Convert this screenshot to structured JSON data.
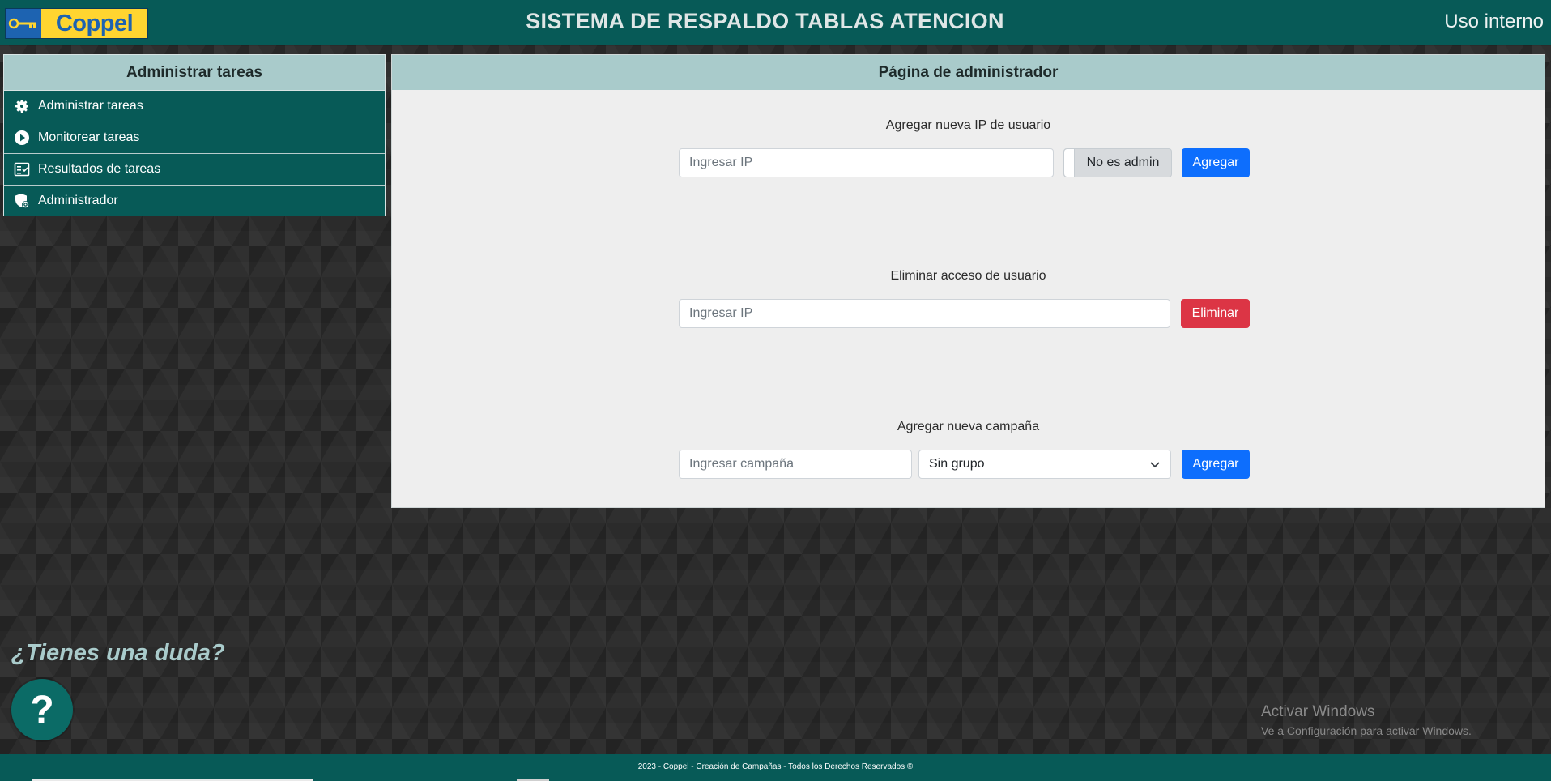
{
  "header": {
    "logo_text": "Coppel",
    "title": "SISTEMA DE RESPALDO TABLAS ATENCION",
    "usage_label": "Uso interno"
  },
  "sidebar": {
    "title": "Administrar tareas",
    "items": [
      {
        "label": "Administrar tareas",
        "icon": "gear-icon"
      },
      {
        "label": "Monitorear tareas",
        "icon": "play-circle-icon"
      },
      {
        "label": "Resultados de tareas",
        "icon": "checklist-icon"
      },
      {
        "label": "Administrador",
        "icon": "shield-admin-icon"
      }
    ]
  },
  "main": {
    "title": "Página de administrador",
    "add_ip": {
      "label": "Agregar nueva IP de usuario",
      "placeholder": "Ingresar IP",
      "toggle_label": "No es admin",
      "button": "Agregar"
    },
    "remove_access": {
      "label": "Eliminar acceso de usuario",
      "placeholder": "Ingresar IP",
      "button": "Eliminar"
    },
    "add_campaign": {
      "label": "Agregar nueva campaña",
      "placeholder": "Ingresar campaña",
      "group_selected": "Sin grupo",
      "button": "Agregar"
    }
  },
  "help": {
    "question": "¿Tienes una duda?",
    "button": "?"
  },
  "watermark": {
    "line1": "Activar Windows",
    "line2": "Ve a Configuración para activar Windows."
  },
  "footer": {
    "text": "2023 - Coppel - Creación de Campañas - Todos los Derechos Reservados ©"
  },
  "colors": {
    "header_bg": "#075a57",
    "panel_head_bg": "#a9cbcb",
    "primary": "#0d6efd",
    "danger": "#dc3545",
    "logo_yellow": "#ffd530",
    "logo_blue": "#1d63b1"
  }
}
